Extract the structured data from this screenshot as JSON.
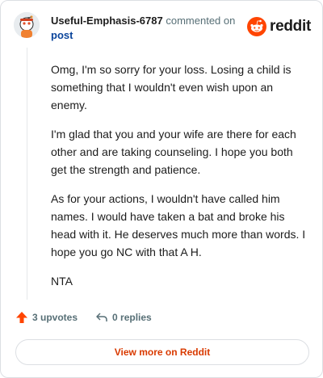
{
  "comment": {
    "username": "Useful-Emphasis-6787",
    "commented_on": "commented on",
    "post_link": "post",
    "paragraphs": [
      "Omg, I'm so sorry for your loss. Losing a child is something that I wouldn't even wish upon an enemy.",
      "I'm glad that you and your wife are there for each other and are taking counseling. I hope you both get the strength and patience.",
      "As for your actions, I wouldn't have called him names. I would have taken a bat and broke his head with it. He deserves much more than words. I hope you go NC with that A H.",
      "NTA"
    ]
  },
  "brand": {
    "wordmark": "reddit",
    "color": "#ff4500"
  },
  "actions": {
    "upvotes": "3 upvotes",
    "replies": "0 replies",
    "upvote_color": "#ff4500"
  },
  "footer": {
    "view_more": "View more on Reddit"
  },
  "icons": [
    "avatar-snoo",
    "reddit-logo-icon",
    "upvote-arrow-icon",
    "reply-icon"
  ]
}
